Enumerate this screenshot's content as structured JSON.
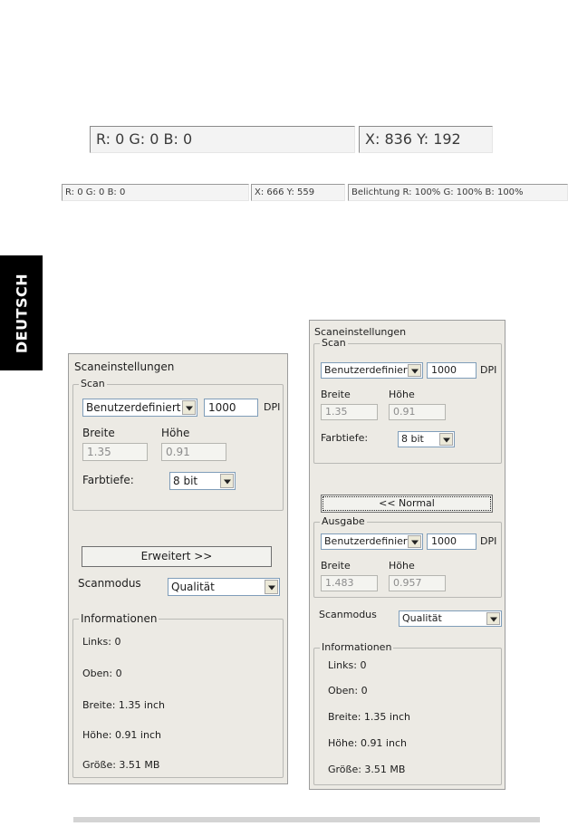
{
  "statusbar_large": {
    "rgb": "R: 0 G: 0 B: 0",
    "xy": "X: 836 Y: 192"
  },
  "statusbar_small": {
    "rgb": "R: 0 G: 0 B: 0",
    "xy": "X: 666 Y: 559",
    "exposure": "Belichtung R: 100% G: 100% B: 100%"
  },
  "side_tab": {
    "label": "DEUTSCH"
  },
  "panel_left": {
    "title": "Scaneinstellungen",
    "scan": {
      "legend": "Scan",
      "preset": "Benutzerdefiniert",
      "dpi_value": "1000",
      "dpi_label": "DPI",
      "width_label": "Breite",
      "height_label": "Höhe",
      "width_value": "1.35",
      "height_value": "0.91",
      "depth_label": "Farbtiefe:",
      "depth_value": "8 bit"
    },
    "toggle_button": "Erweitert >>",
    "mode_label": "Scanmodus",
    "mode_value": "Qualität",
    "info": {
      "legend": "Informationen",
      "left": "Links: 0",
      "top": "Oben: 0",
      "width": "Breite: 1.35 inch",
      "height": "Höhe: 0.91 inch",
      "size": "Größe: 3.51 MB"
    }
  },
  "panel_right": {
    "title": "Scaneinstellungen",
    "scan": {
      "legend": "Scan",
      "preset": "Benutzerdefiniert",
      "dpi_value": "1000",
      "dpi_label": "DPI",
      "width_label": "Breite",
      "height_label": "Höhe",
      "width_value": "1.35",
      "height_value": "0.91",
      "depth_label": "Farbtiefe:",
      "depth_value": "8 bit"
    },
    "toggle_button": "<< Normal",
    "output": {
      "legend": "Ausgabe",
      "preset": "Benutzerdefiniert",
      "dpi_value": "1000",
      "dpi_label": "DPI",
      "width_label": "Breite",
      "height_label": "Höhe",
      "width_value": "1.483",
      "height_value": "0.957"
    },
    "mode_label": "Scanmodus",
    "mode_value": "Qualität",
    "info": {
      "legend": "Informationen",
      "left": "Links: 0",
      "top": "Oben: 0",
      "width": "Breite: 1.35 inch",
      "height": "Höhe: 0.91 inch",
      "size": "Größe: 3.51 MB"
    }
  }
}
